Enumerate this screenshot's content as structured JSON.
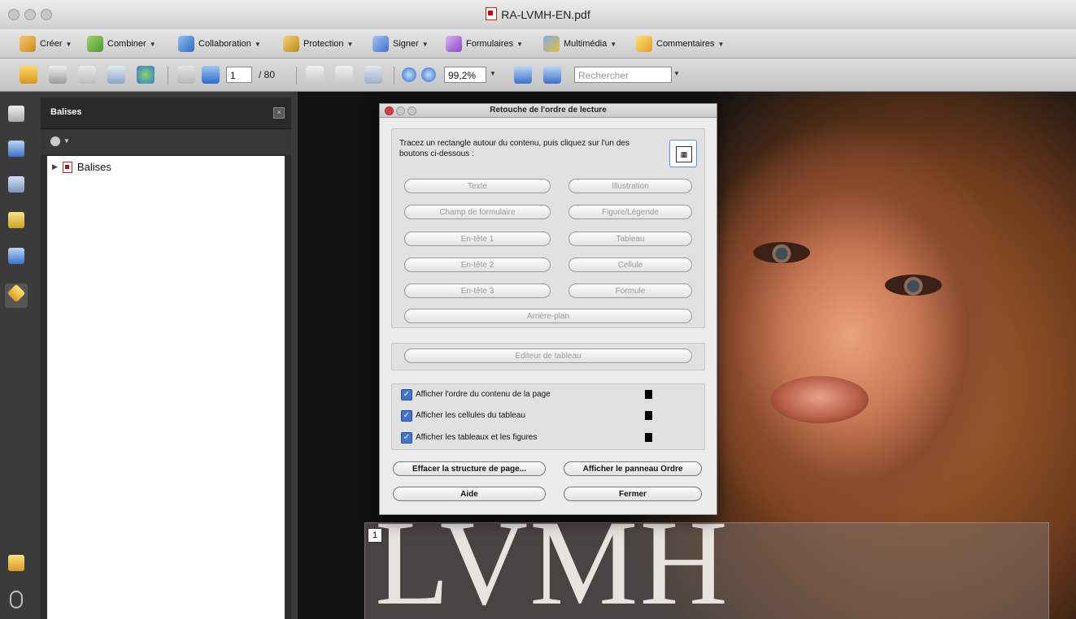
{
  "window": {
    "title": "RA-LVMH-EN.pdf"
  },
  "toolbar1": {
    "items": [
      {
        "label": "Créer",
        "icon": "create-icon"
      },
      {
        "label": "Combiner",
        "icon": "combine-icon"
      },
      {
        "label": "Collaboration",
        "icon": "collaboration-icon"
      },
      {
        "label": "Protection",
        "icon": "lock-icon"
      },
      {
        "label": "Signer",
        "icon": "pen-icon"
      },
      {
        "label": "Formulaires",
        "icon": "forms-icon"
      },
      {
        "label": "Multimédia",
        "icon": "multimedia-icon"
      },
      {
        "label": "Commentaires",
        "icon": "comment-icon"
      }
    ]
  },
  "toolbar2": {
    "page_current": "1",
    "page_total": "/ 80",
    "zoom": "99,2%",
    "search_placeholder": "Rechercher"
  },
  "panel": {
    "title": "Balises",
    "close_glyph": "×",
    "tree_root": "Balises",
    "expander": "▶"
  },
  "document": {
    "page_number": "1",
    "heading": "LVMH"
  },
  "dialog": {
    "title": "Retouche de l'ordre de lecture",
    "instructions": "Tracez un rectangle autour du contenu, puis cliquez sur l'un des boutons ci-dessous :",
    "buttons_left": [
      "Texte",
      "Champ de formulaire",
      "En-tête 1",
      "En-tête 2",
      "En-tête 3"
    ],
    "buttons_right": [
      "Illustration",
      "Figure/Légende",
      "Tableau",
      "Cellule",
      "Formule"
    ],
    "background_button": "Arrière-plan",
    "table_editor_button": "Editeur de tableau",
    "checkboxes": [
      {
        "label": "Afficher l'ordre du contenu de la page",
        "checked": true
      },
      {
        "label": "Afficher les cellules du tableau",
        "checked": true
      },
      {
        "label": "Afficher les tableaux et les figures",
        "checked": true
      }
    ],
    "clear_structure_button": "Effacer la structure de page...",
    "show_order_button": "Afficher le panneau Ordre",
    "help_button": "Aide",
    "close_button": "Fermer"
  },
  "colors": {
    "checkbox": "#3f75d1",
    "panel_dark": "#2e2e2e",
    "toolbar": "#d6d6d6"
  }
}
